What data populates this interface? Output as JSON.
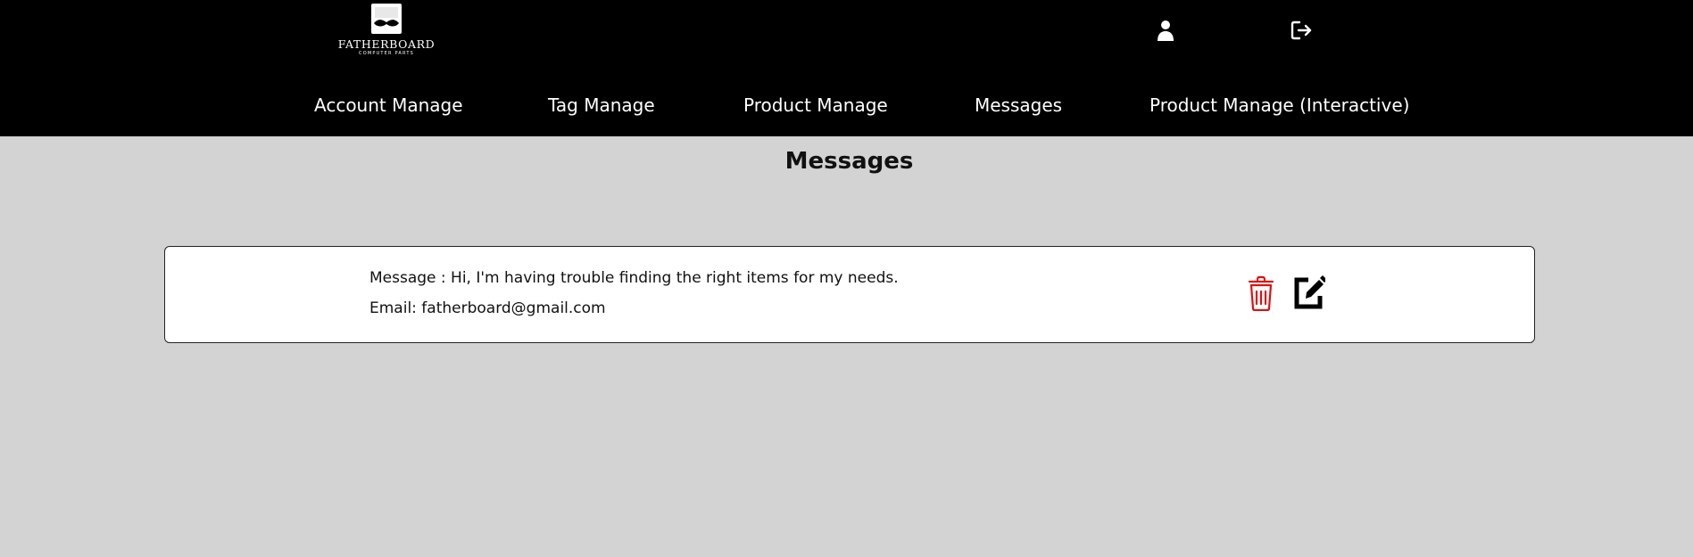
{
  "header": {
    "logo": {
      "name": "FATHERBOARD",
      "tagline": "COMPUTER PARTS",
      "icon": "mustache-logo-icon"
    },
    "icons": [
      "user-icon",
      "logout-icon"
    ]
  },
  "nav": {
    "items": [
      {
        "label": "Account Manage"
      },
      {
        "label": "Tag Manage"
      },
      {
        "label": "Product Manage"
      },
      {
        "label": "Messages"
      },
      {
        "label": "Product Manage (Interactive)"
      }
    ]
  },
  "main": {
    "title": "Messages",
    "messages": [
      {
        "message_line": "Message : Hi, I'm having trouble finding the right items for my needs.",
        "email_line": "Email: fatherboard@gmail.com",
        "actions": [
          "trash-icon",
          "edit-icon"
        ]
      }
    ]
  },
  "colors": {
    "header_bg": "#000000",
    "page_bg": "#d3d3d3",
    "card_bg": "#ffffff",
    "delete": "#e01010",
    "text": "#111111"
  }
}
